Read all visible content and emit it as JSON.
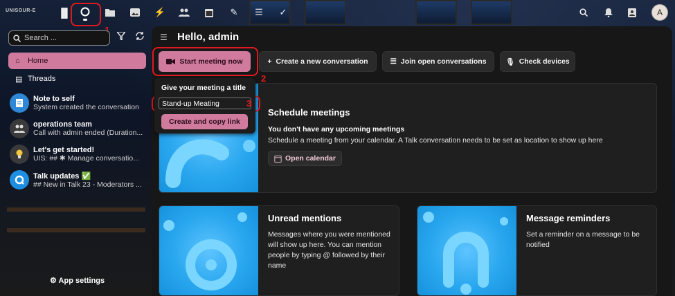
{
  "topbar": {
    "logo": "UNISOUR-E",
    "apps": [
      {
        "name": "dashboard",
        "glyph": "▐▌"
      },
      {
        "name": "talk",
        "glyph": "○"
      },
      {
        "name": "files",
        "glyph": "▬"
      },
      {
        "name": "photos",
        "glyph": "▣"
      },
      {
        "name": "activity",
        "glyph": "⚡"
      },
      {
        "name": "contacts",
        "glyph": "☺"
      },
      {
        "name": "calendar",
        "glyph": "▦"
      },
      {
        "name": "notes",
        "glyph": "✎"
      },
      {
        "name": "deck",
        "glyph": "☰"
      },
      {
        "name": "tasks",
        "glyph": "✓"
      }
    ],
    "avatar_letter": "A"
  },
  "sidebar": {
    "search_placeholder": "Search ...",
    "nav": [
      {
        "label": "Home"
      },
      {
        "label": "Threads"
      }
    ],
    "conversations": [
      {
        "name": "Note to self",
        "sub": "System created the conversation",
        "color": "#2f88d6",
        "glyph": "✍"
      },
      {
        "name": "operations team",
        "sub": "Call with admin ended (Duration...",
        "color": "#3a3a3a",
        "glyph": "☺"
      },
      {
        "name": "Let's get started!",
        "sub": "UIS: ## ✱ Manage conversatio...",
        "color": "#3a3a3a",
        "glyph": "●"
      },
      {
        "name": "Talk updates ✅",
        "sub": "## New in Talk 23 - Moderators ...",
        "color": "#1e8fe0",
        "glyph": "Q"
      }
    ],
    "app_settings": "App settings"
  },
  "main": {
    "hello": "Hello, admin",
    "buttons": {
      "start_meeting": "Start meeting now",
      "create_conversation": "Create a new conversation",
      "join_open": "Join open conversations",
      "check_devices": "Check devices"
    },
    "popup": {
      "title": "Give your meeting a title",
      "input_value": "Stand-up Meating",
      "create_btn": "Create and copy link"
    },
    "cards": {
      "schedule": {
        "title": "Schedule meetings",
        "bold": "You don't have any upcoming meetings",
        "body": "Schedule a meeting from your calendar. A Talk conversation needs to be set as location to show up here",
        "button": "Open calendar"
      },
      "mentions": {
        "title": "Unread mentions",
        "body": "Messages where you were mentioned will show up here. You can mention people by typing @ followed by their name"
      },
      "reminders": {
        "title": "Message reminders",
        "body": "Set a reminder on a message to be notified"
      }
    }
  },
  "annotations": {
    "n1": "1",
    "n2": "2",
    "n3": "3"
  }
}
